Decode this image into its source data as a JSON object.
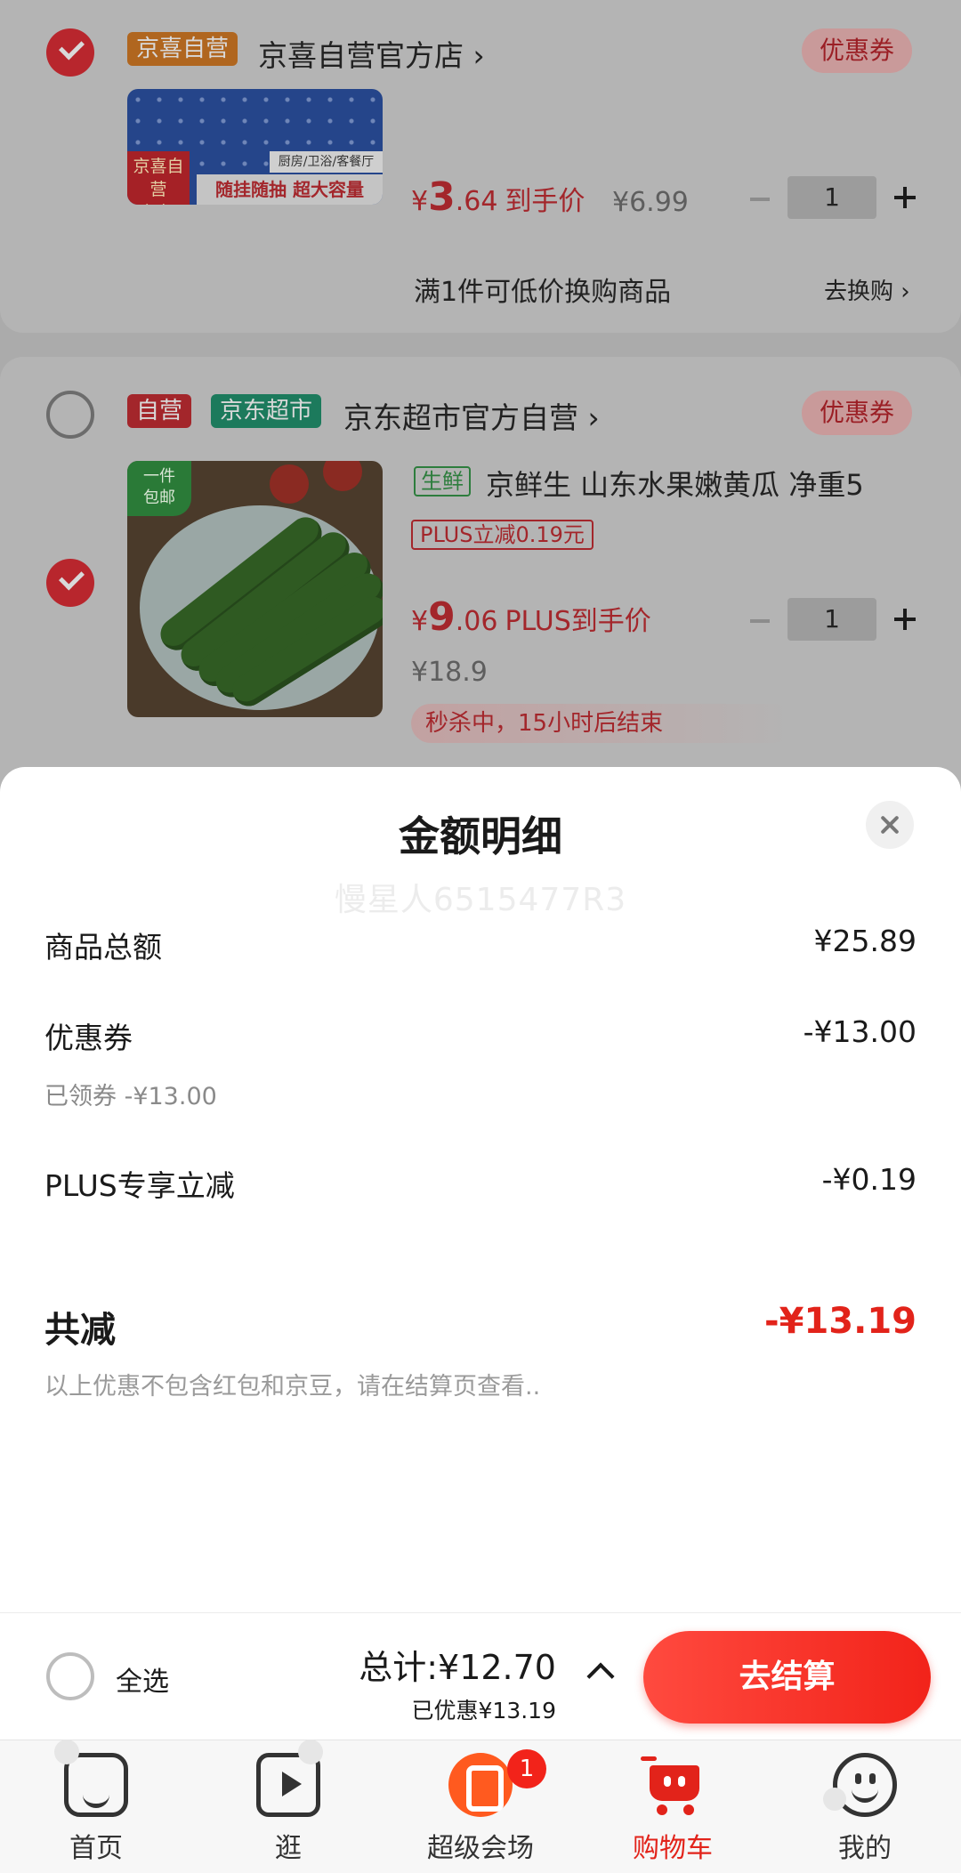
{
  "cart": {
    "store1": {
      "tag": "京喜自营",
      "name": "京喜自营官方店 ›",
      "coupon": "优惠券",
      "product": {
        "image_ribbon": "京喜自营\n包邮",
        "image_rooms": "厨房/卫浴/客餐厅",
        "image_slogan": "随挂随抽 超大容量",
        "price_yen": "¥",
        "price_int": "3",
        "price_dec": ".64",
        "price_suffix": "到手价",
        "original_price": "¥6.99",
        "quantity": "1"
      },
      "promo_text": "满1件可低价换购商品",
      "promo_link": "去换购 ›"
    },
    "store2": {
      "tag_self": "自营",
      "tag_market": "京东超市",
      "name": "京东超市官方自营 ›",
      "coupon": "优惠券",
      "product": {
        "image_badge": "一件\n包邮",
        "fresh_tag": "生鲜",
        "title": "京鲜生 山东水果嫩黄瓜 净重5",
        "plus_tag": "PLUS立减0.19元",
        "price_yen": "¥",
        "price_int": "9",
        "price_dec": ".06",
        "price_suffix": "PLUS到手价",
        "original_price": "¥18.9",
        "flash_sale": "秒杀中，15小时后结束",
        "quantity": "1"
      }
    }
  },
  "sheet": {
    "title": "金额明细",
    "watermark": "慢星人6515477R3",
    "rows": [
      {
        "label": "商品总额",
        "value": "¥25.89"
      },
      {
        "label": "优惠券",
        "value": "-¥13.00",
        "sub": "已领券 -¥13.00"
      },
      {
        "label": "PLUS专享立减",
        "value": "-¥0.19"
      }
    ],
    "total_label": "共减",
    "total_value": "-¥13.19",
    "disclaimer": "以上优惠不包含红包和京豆，请在结算页查看.."
  },
  "checkout": {
    "select_all": "全选",
    "total": "总计:¥12.70",
    "saved": "已优惠¥13.19",
    "button": "去结算"
  },
  "tabbar": {
    "items": [
      {
        "label": "首页",
        "icon": "home-icon"
      },
      {
        "label": "逛",
        "icon": "video-icon"
      },
      {
        "label": "超级会场",
        "icon": "super-venue-icon",
        "badge": "1"
      },
      {
        "label": "购物车",
        "icon": "cart-icon",
        "active": true
      },
      {
        "label": "我的",
        "icon": "profile-icon"
      }
    ]
  },
  "colors": {
    "accent": "#e2231a",
    "checkout_button": "#f2231a",
    "overlay": "#9e9e9e"
  }
}
